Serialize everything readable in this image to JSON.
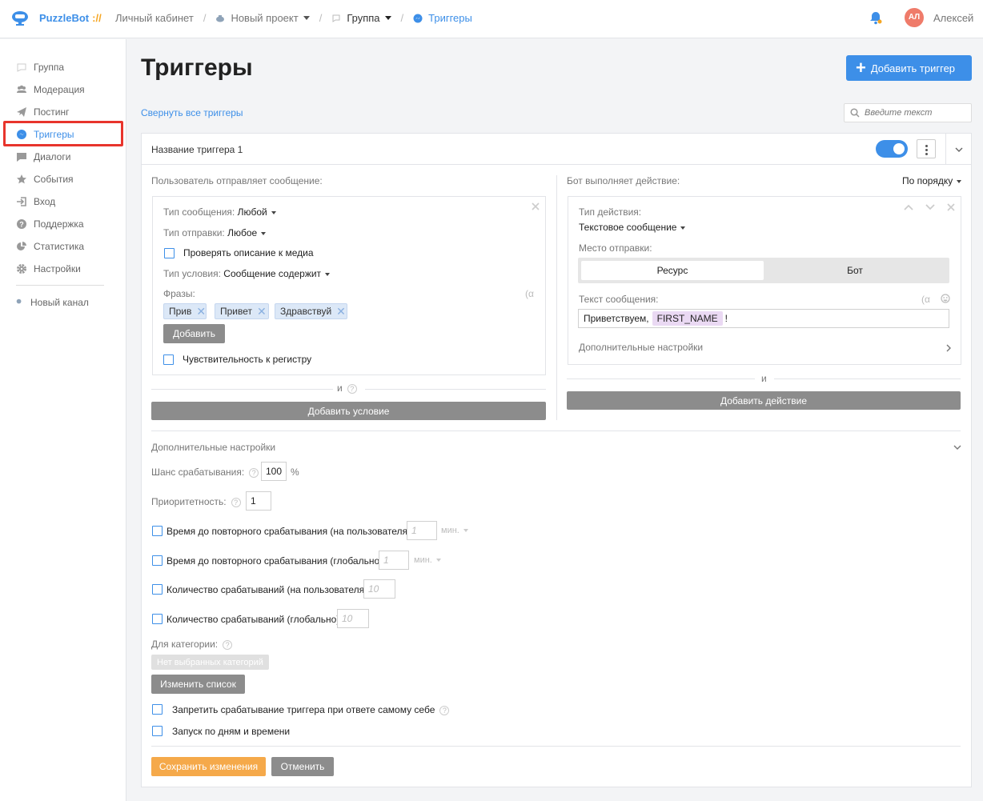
{
  "header": {
    "brand": "PuzzleBot",
    "brand_slash": "://",
    "breadcrumbs": {
      "cabinet": "Личный кабинет",
      "project": "Новый проект",
      "group": "Группа",
      "triggers": "Триггеры"
    },
    "avatar_initials": "АЛ",
    "username": "Алексей"
  },
  "sidebar": {
    "items": [
      {
        "label": "Группа",
        "icon": "chat-bubble-icon"
      },
      {
        "label": "Модерация",
        "icon": "users-icon"
      },
      {
        "label": "Постинг",
        "icon": "paper-plane-icon"
      },
      {
        "label": "Триггеры",
        "icon": "messenger-icon",
        "active": true
      },
      {
        "label": "Диалоги",
        "icon": "comment-icon"
      },
      {
        "label": "События",
        "icon": "star-icon"
      },
      {
        "label": "Вход",
        "icon": "login-icon"
      },
      {
        "label": "Поддержка",
        "icon": "help-icon"
      },
      {
        "label": "Статистика",
        "icon": "pie-chart-icon"
      },
      {
        "label": "Настройки",
        "icon": "gear-icon"
      }
    ],
    "new_channel": "Новый канал"
  },
  "main": {
    "title": "Триггеры",
    "add_trigger": "Добавить триггер",
    "collapse_all": "Свернуть все триггеры",
    "search_placeholder": "Введите текст"
  },
  "trigger": {
    "name": "Название триггера 1",
    "enabled": true,
    "condition": {
      "heading": "Пользователь отправляет сообщение:",
      "msg_type_label": "Тип сообщения:",
      "msg_type_value": "Любой",
      "send_type_label": "Тип отправки:",
      "send_type_value": "Любое",
      "check_media": "Проверять описание к медиа",
      "cond_type_label": "Тип условия:",
      "cond_type_value": "Сообщение содержит",
      "phrases_label": "Фразы:",
      "phrases": [
        "Прив",
        "Привет",
        "Здравствуй"
      ],
      "add": "Добавить",
      "case_sensitive": "Чувствительность к регистру",
      "and": "и",
      "add_condition": "Добавить условие"
    },
    "action": {
      "heading": "Бот выполняет действие:",
      "order": "По порядку",
      "action_type_label": "Тип действия:",
      "action_type_value": "Текстовое сообщение",
      "send_place_label": "Место отправки:",
      "seg_resource": "Ресурс",
      "seg_bot": "Бот",
      "msg_text_label": "Текст сообщения:",
      "msg_text": "Приветствуем,",
      "msg_var": "FIRST_NAME",
      "msg_tail": "!",
      "extra_settings": "Дополнительные настройки",
      "and": "и",
      "add_action": "Добавить действие"
    },
    "extra": {
      "heading": "Дополнительные настройки",
      "chance_label": "Шанс срабатывания:",
      "chance_value": "100",
      "chance_unit": "%",
      "priority_label": "Приоритетность:",
      "priority_value": "1",
      "repeat_user": "Время до повторного срабатывания (на пользователя)",
      "repeat_user_ph": "1",
      "repeat_user_unit": "мин.",
      "repeat_global": "Время до повторного срабатывания (глобально)",
      "repeat_global_ph": "1",
      "repeat_global_unit": "мин.",
      "count_user": "Количество срабатываний (на пользователя)",
      "count_user_ph": "10",
      "count_global": "Количество срабатываний (глобально)",
      "count_global_ph": "10",
      "category_label": "Для категории:",
      "no_categories": "Нет выбранных категорий",
      "change_list": "Изменить список",
      "forbid_self": "Запретить срабатывание триггера при ответе самому себе",
      "schedule": "Запуск по дням и времени"
    },
    "save": "Сохранить изменения",
    "cancel": "Отменить"
  },
  "colors": {
    "accent": "#3d8fe8",
    "brand_slash": "#f5a623",
    "highlight": "#e8342c",
    "save": "#f5a94a",
    "grey_button": "#8c8c8c"
  }
}
